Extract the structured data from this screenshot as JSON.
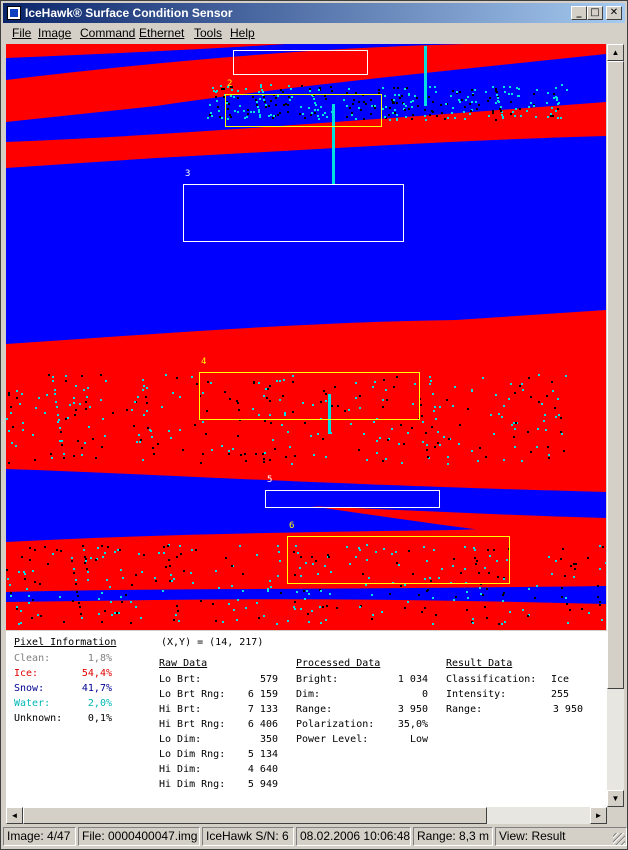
{
  "window": {
    "title": "IceHawk® Surface Condition Sensor",
    "controls": {
      "minimize": "_",
      "maximize": "□",
      "close": "✕"
    }
  },
  "menu": [
    {
      "label": "File"
    },
    {
      "label": "Image"
    },
    {
      "label": "Command"
    },
    {
      "label": "Ethernet"
    },
    {
      "label": "Tools"
    },
    {
      "label": "Help"
    }
  ],
  "image_view": {
    "colors": {
      "ice": "#ff0000",
      "snow": "#0000ff",
      "water": "#00e0e0",
      "unknown": "#000000"
    },
    "regions": [
      {
        "label": "",
        "border": "#ffffff"
      },
      {
        "label": "2",
        "border": "#ffff00"
      },
      {
        "label": "3",
        "border": "#ffffff"
      },
      {
        "label": "4",
        "border": "#ffff00"
      },
      {
        "label": "5",
        "border": "#ffffff"
      },
      {
        "label": "6",
        "border": "#ffff00"
      }
    ]
  },
  "pixel_info": {
    "title": "Pixel Information",
    "rows": [
      {
        "label": "Clean:",
        "value": "1,8%",
        "color": "#808080"
      },
      {
        "label": "Ice:",
        "value": "54,4%",
        "color": "#e00000"
      },
      {
        "label": "Snow:",
        "value": "41,7%",
        "color": "#000090"
      },
      {
        "label": "Water:",
        "value": "2,0%",
        "color": "#00b8b8"
      },
      {
        "label": "Unknown:",
        "value": "0,1%",
        "color": "#000000"
      }
    ]
  },
  "coords": "(X,Y) = (14, 217)",
  "raw_data": {
    "title": "Raw Data",
    "rows": [
      {
        "label": "Lo Brt:",
        "value": "579"
      },
      {
        "label": "Lo Brt Rng:",
        "value": "6 159"
      },
      {
        "label": "Hi Brt:",
        "value": "7 133"
      },
      {
        "label": "Hi Brt Rng:",
        "value": "6 406"
      },
      {
        "label": "Lo Dim:",
        "value": "350"
      },
      {
        "label": "Lo Dim Rng:",
        "value": "5 134"
      },
      {
        "label": "Hi Dim:",
        "value": "4 640"
      },
      {
        "label": "Hi Dim Rng:",
        "value": "5 949"
      }
    ]
  },
  "processed_data": {
    "title": "Processed Data",
    "rows": [
      {
        "label": "Bright:",
        "value": "1 034"
      },
      {
        "label": "Dim:",
        "value": "0"
      },
      {
        "label": "Range:",
        "value": "3 950"
      },
      {
        "label": "Polarization:",
        "value": "35,0%"
      },
      {
        "label": "Power Level:",
        "value": "Low"
      }
    ]
  },
  "result_data": {
    "title": "Result Data",
    "rows": [
      {
        "label": "Classification:",
        "value": "Ice"
      },
      {
        "label": "Intensity:",
        "value": "255"
      },
      {
        "label": "Range:",
        "value": "3 950"
      }
    ]
  },
  "status": {
    "image": "Image: 4/47",
    "file": "File: 0000400047.img",
    "serial": "IceHawk S/N: 6",
    "datetime": "08.02.2006 10:06:48",
    "range": "Range: 8,3 m",
    "view": "View: Result"
  },
  "scroll": {
    "up": "▲",
    "down": "▼",
    "left": "◄",
    "right": "►"
  }
}
